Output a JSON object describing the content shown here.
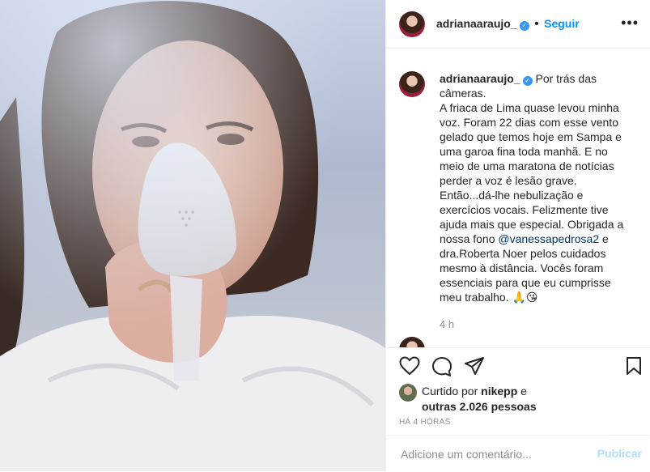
{
  "post": {
    "username": "adrianaaraujo_",
    "follow_label": "Seguir",
    "more_icon": "more-horizontal-icon"
  },
  "caption": {
    "username": "adrianaaraujo_",
    "text_before_mention": "Por trás das câmeras.\nA friaca de Lima quase levou minha voz. Foram 22 dias com esse vento gelado que temos hoje em Sampa e uma garoa fina toda manhã. E no meio de uma maratona de notícias perder a voz é lesão grave. Então...dá-lhe nebulização e exercícios vocais. Felizmente tive ajuda mais que especial. Obrigada a nossa fono ",
    "mention": "@vanessapedrosa2",
    "text_after_mention": " e dra.Roberta Noer pelos cuidados mesmo à distância. Vocês foram essenciais para que eu cumprisse meu trabalho. 🙏😘",
    "time": "4 h"
  },
  "likes": {
    "prefix": "Curtido por ",
    "first_liker": "nikepp",
    "connector": " e",
    "others": "outras 2.026 pessoas"
  },
  "timestamp": "HÁ 4 HORAS",
  "comment_input": {
    "placeholder": "Adicione um comentário...",
    "publish_label": "Publicar"
  },
  "colors": {
    "link": "#0095f6",
    "mention": "#00376b",
    "verified": "#3897f0",
    "publish_disabled": "#b2dffc"
  }
}
